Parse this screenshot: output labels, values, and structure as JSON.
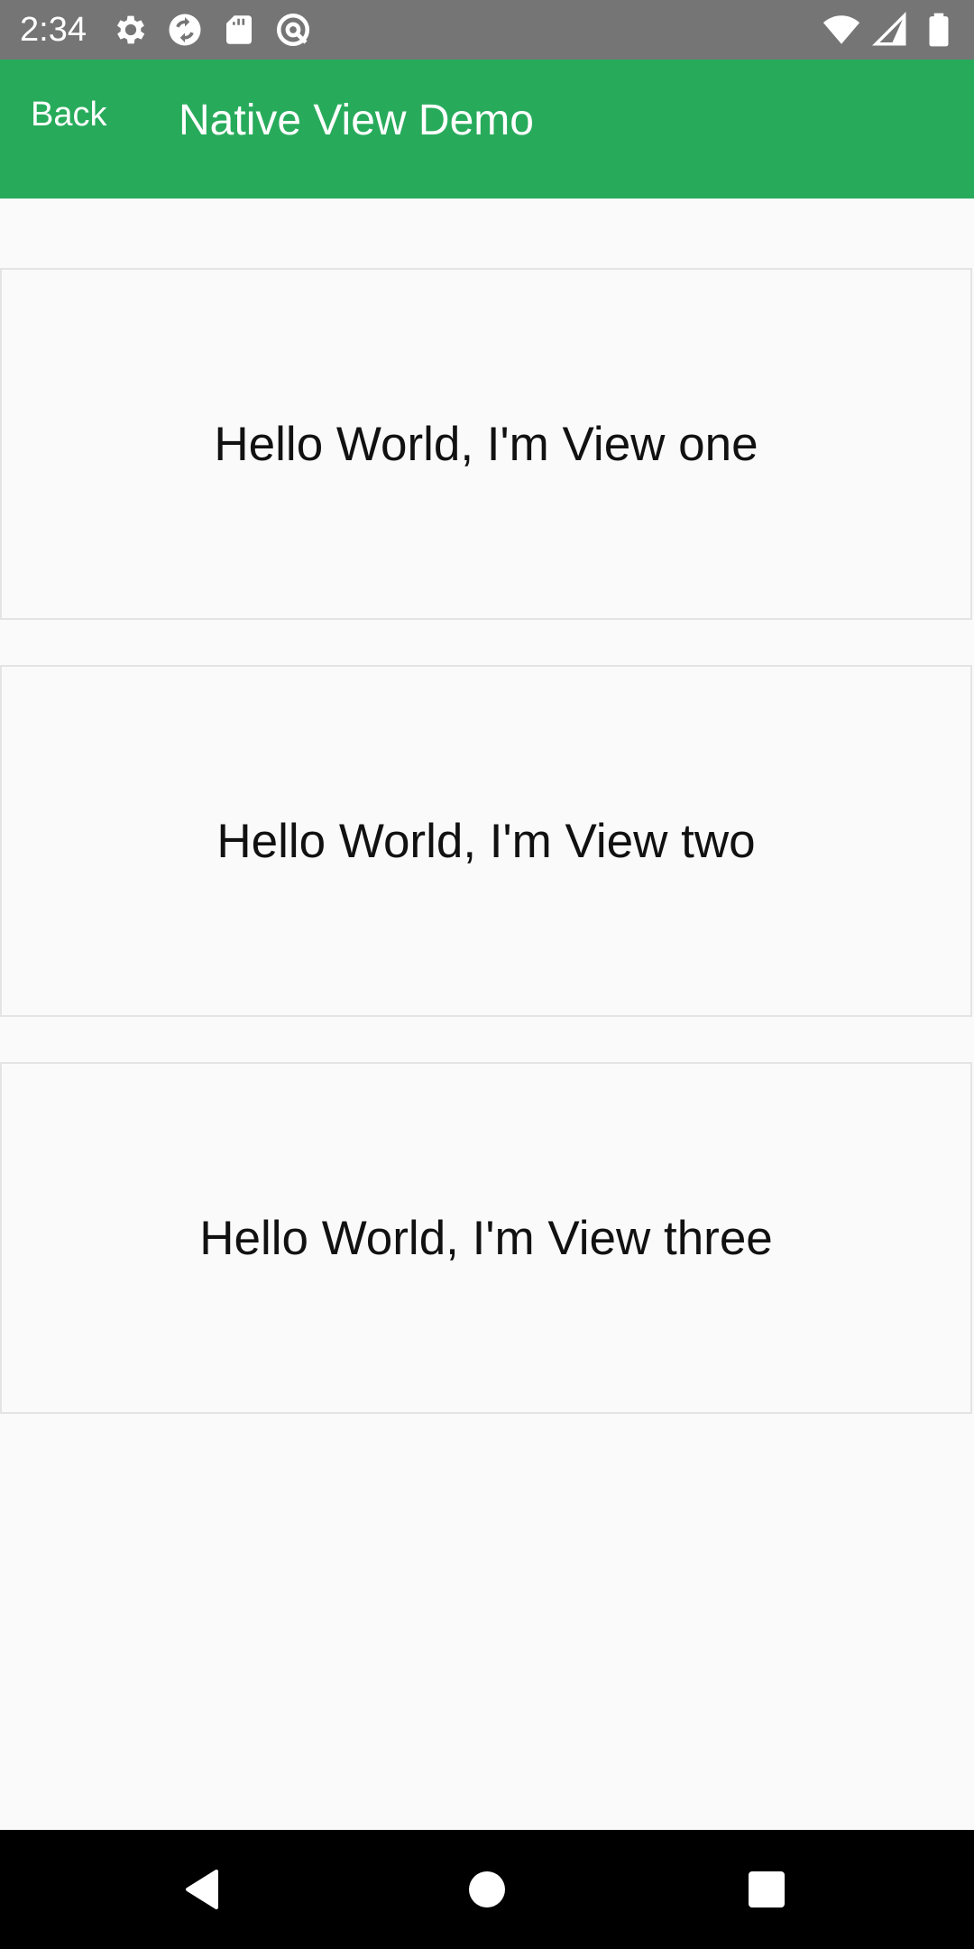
{
  "status_bar": {
    "time": "2:34",
    "left_icons": [
      "settings-icon",
      "sync-icon",
      "sd-card-icon",
      "at-sign-icon"
    ],
    "right_icons": [
      "wifi-icon",
      "cell-signal-icon",
      "battery-icon"
    ]
  },
  "app_bar": {
    "back_label": "Back",
    "title": "Native View Demo",
    "background_color": "#27ab5b"
  },
  "views": [
    {
      "text": "Hello World, I'm View one"
    },
    {
      "text": "Hello World, I'm View two"
    },
    {
      "text": "Hello World, I'm View three"
    }
  ],
  "nav_bar": {
    "buttons": [
      "nav-back-icon",
      "nav-home-icon",
      "nav-recents-icon"
    ]
  }
}
